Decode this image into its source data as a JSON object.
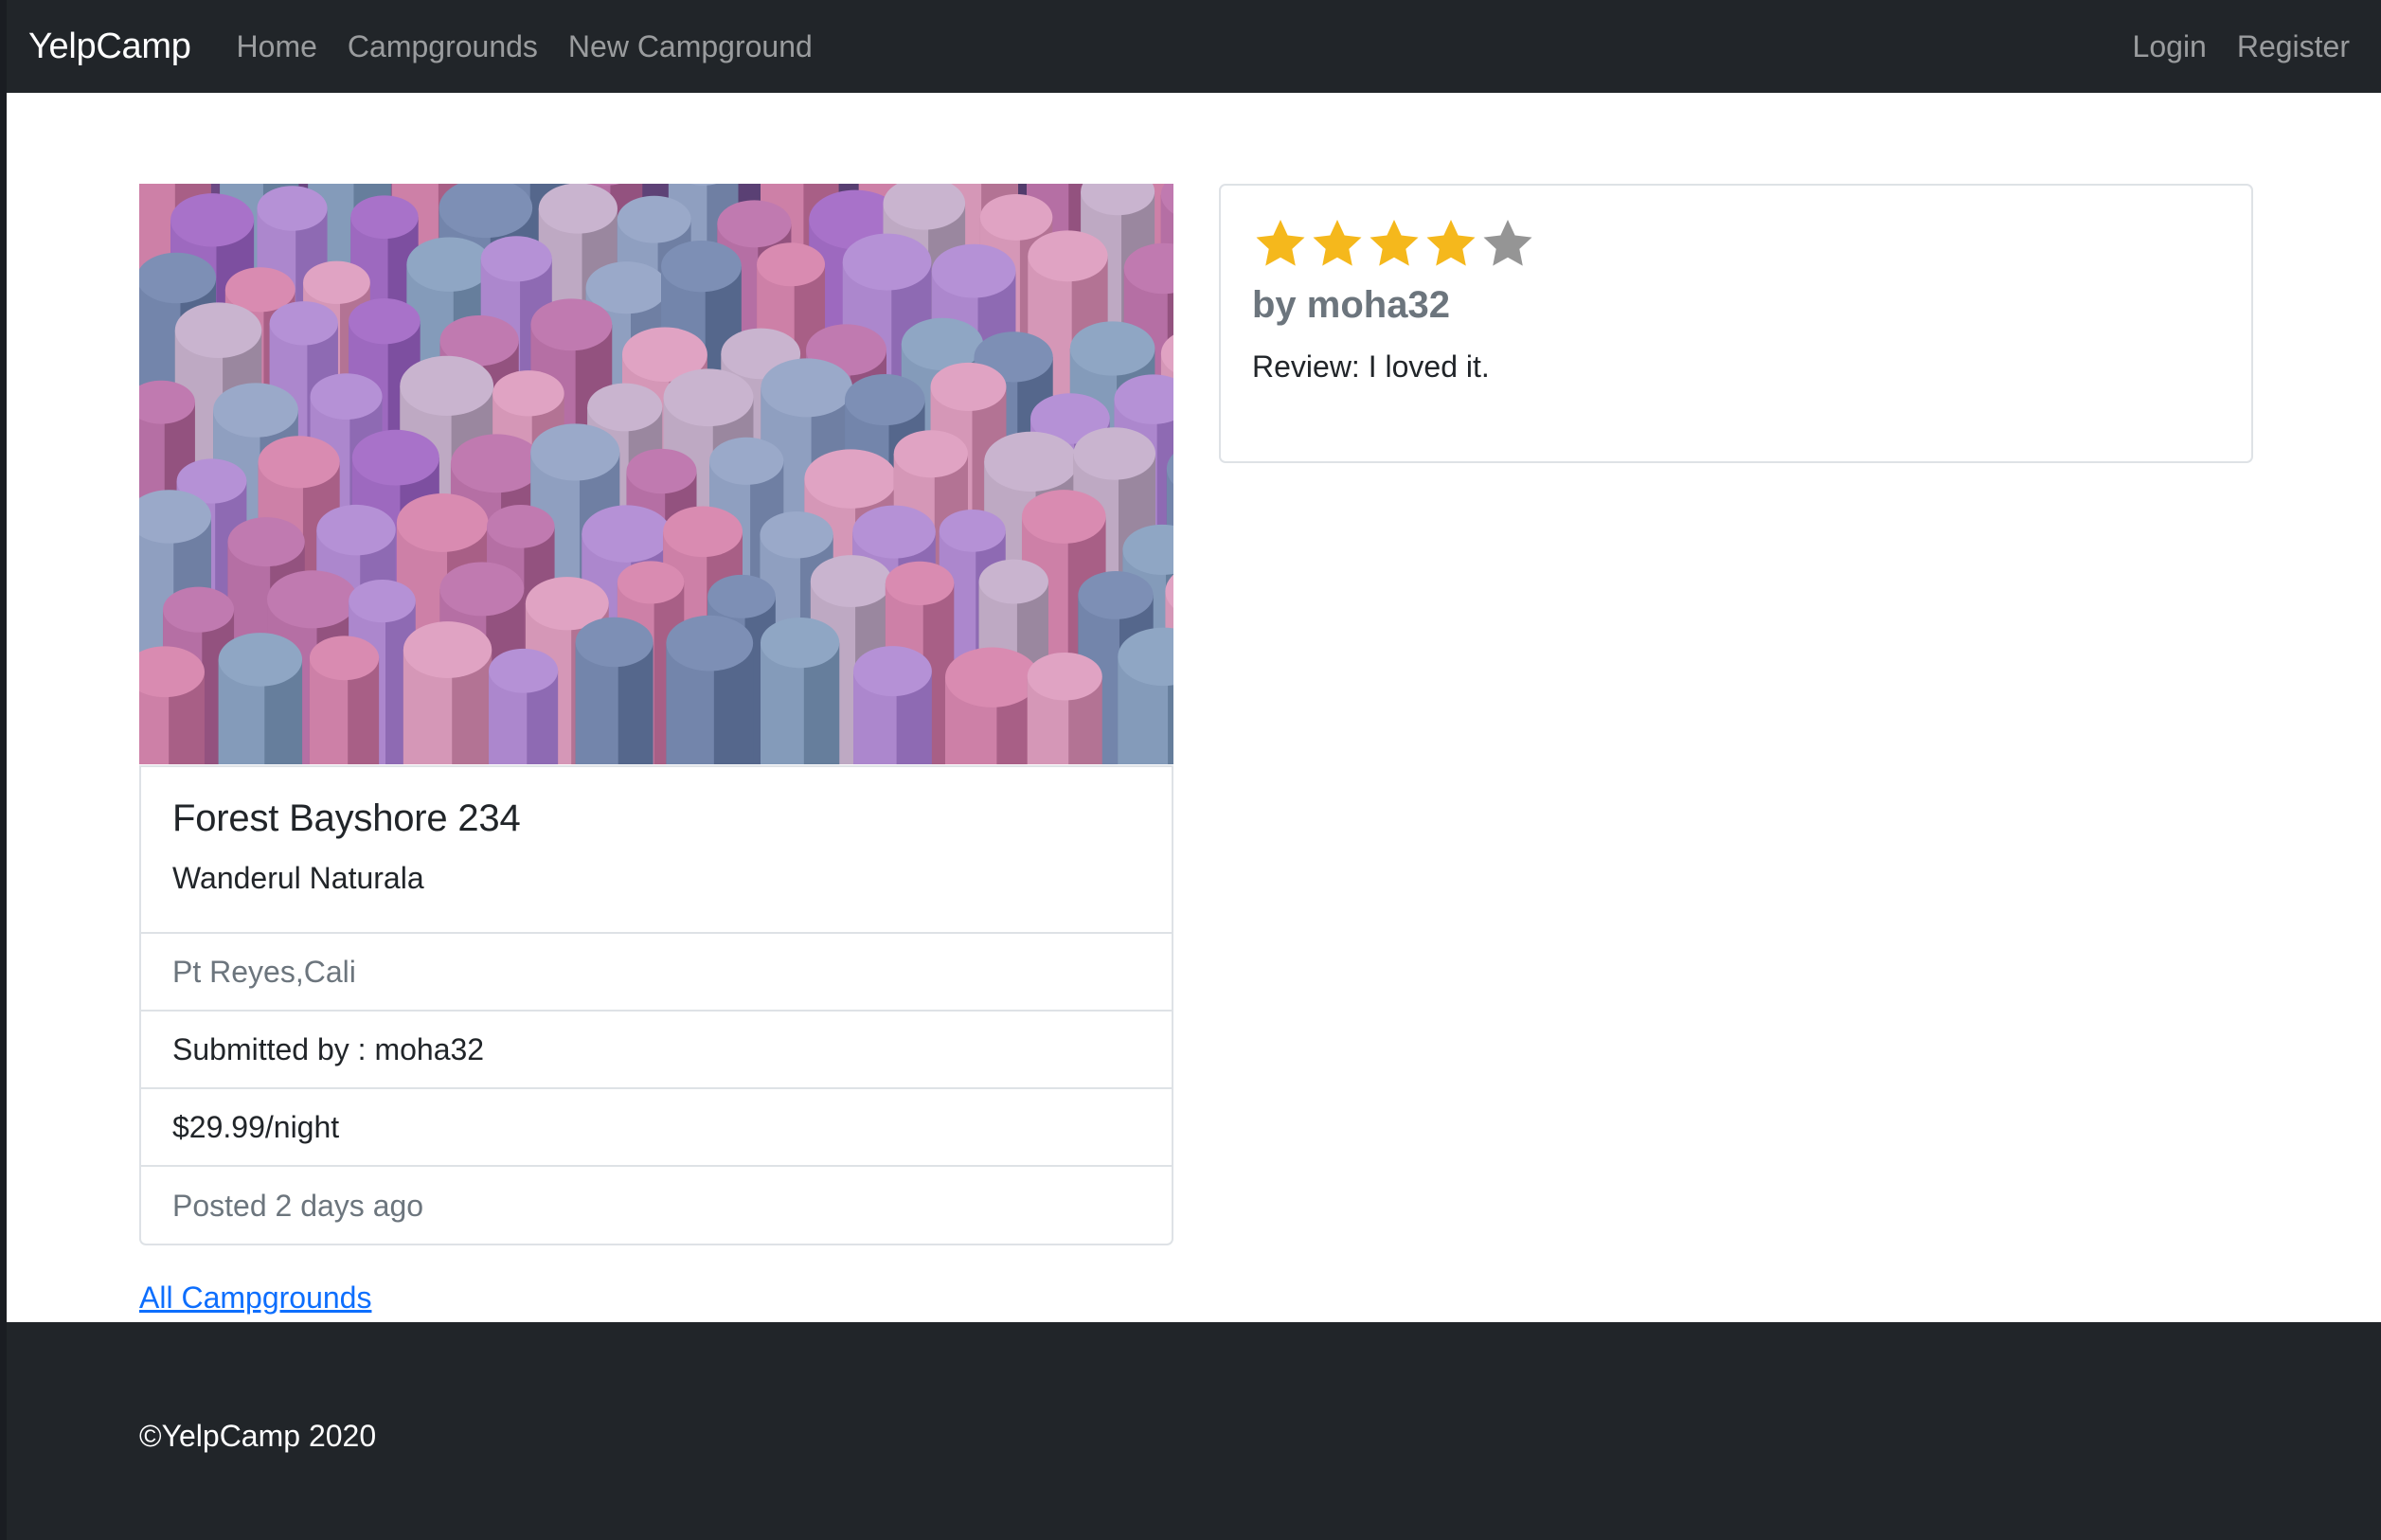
{
  "navbar": {
    "brand": "YelpCamp",
    "links": [
      "Home",
      "Campgrounds",
      "New Campground"
    ],
    "right_links": [
      "Login",
      "Register"
    ]
  },
  "campground": {
    "title": "Forest Bayshore 234",
    "description": "Wanderul Naturala",
    "location": "Pt Reyes,Cali",
    "submitted_by": "Submitted by : moha32",
    "price": "$29.99/night",
    "posted": "Posted 2 days ago",
    "back_link": "All Campgrounds"
  },
  "review": {
    "rating": 4,
    "max_rating": 5,
    "author": "by moha32",
    "text": "Review: I loved it."
  },
  "footer": {
    "copyright": "©YelpCamp 2020"
  },
  "colors": {
    "navbar_bg": "#212529",
    "star_filled": "#f5b81c",
    "star_empty": "#959595",
    "link": "#0d6efd"
  }
}
